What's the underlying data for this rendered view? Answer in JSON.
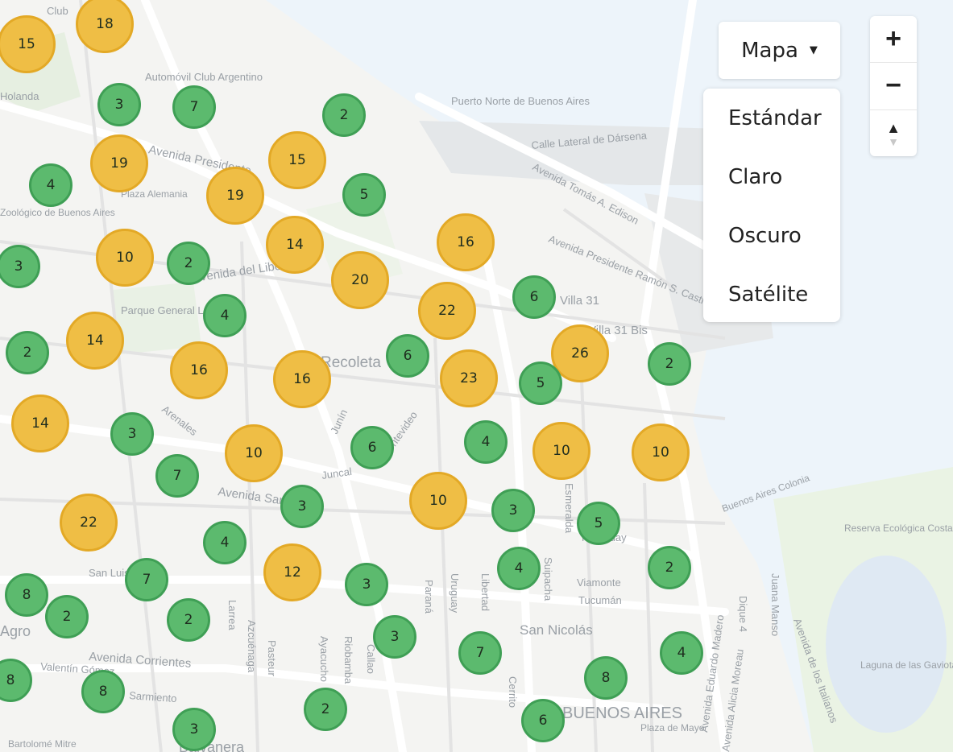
{
  "map": {
    "street_labels": [
      "Avenida Presidente",
      "Avenida del Libertador",
      "Avenida Santa Fe",
      "Avenida Corrientes",
      "Avenida Tomás A. Edison",
      "Avenida Presidente Ramón S. Castillo",
      "Calle Lateral de Dársena",
      "Avenida Eduardo Madero",
      "Avenida Alicia Moreau",
      "Juncal",
      "Arenales",
      "Junín",
      "Paraná",
      "Uruguay",
      "Libertad",
      "Cerrito",
      "Esmeralda",
      "Suipacha",
      "Viamonte",
      "Tucumán",
      "Sarmiento",
      "Pasteur",
      "Azcuénaga",
      "Ayacucho",
      "Riobamba",
      "Callao",
      "Larrea",
      "Juana Manso",
      "Dique 4",
      "Avenida de los Italianos",
      "Buenos Aires Colonia",
      "Paraguay",
      "Montevideo",
      "Bartolomé Mitre",
      "San Luis",
      "Valentín Gómez",
      "Plaza de Mayo"
    ],
    "place_labels": [
      "Club",
      "Automóvil Club Argentino",
      "Puerto Norte de Buenos Aires",
      "Recoleta",
      "San Nicolás",
      "BUENOS AIRES",
      "Reserva Ecológica Costanera Sur",
      "Laguna de las Gaviotas",
      "Villa 31",
      "Villa 31 Bis",
      "Parque General Las Heras",
      "Zoológico de Buenos Aires",
      "Balvanera",
      "Agro",
      "Plaza Alemania",
      "Holanda"
    ]
  },
  "clusters": [
    {
      "count": "15",
      "size": "large"
    },
    {
      "count": "18",
      "size": "large"
    },
    {
      "count": "3",
      "size": "small"
    },
    {
      "count": "7",
      "size": "small"
    },
    {
      "count": "2",
      "size": "small"
    },
    {
      "count": "19",
      "size": "large"
    },
    {
      "count": "15",
      "size": "large"
    },
    {
      "count": "4",
      "size": "small"
    },
    {
      "count": "19",
      "size": "large"
    },
    {
      "count": "5",
      "size": "small"
    },
    {
      "count": "10",
      "size": "large"
    },
    {
      "count": "2",
      "size": "small"
    },
    {
      "count": "14",
      "size": "large"
    },
    {
      "count": "16",
      "size": "large"
    },
    {
      "count": "3",
      "size": "small"
    },
    {
      "count": "20",
      "size": "large"
    },
    {
      "count": "22",
      "size": "large"
    },
    {
      "count": "6",
      "size": "small"
    },
    {
      "count": "4",
      "size": "small"
    },
    {
      "count": "14",
      "size": "large"
    },
    {
      "count": "2",
      "size": "small"
    },
    {
      "count": "16",
      "size": "large"
    },
    {
      "count": "16",
      "size": "large"
    },
    {
      "count": "6",
      "size": "small"
    },
    {
      "count": "23",
      "size": "large"
    },
    {
      "count": "26",
      "size": "large"
    },
    {
      "count": "5",
      "size": "small"
    },
    {
      "count": "2",
      "size": "small"
    },
    {
      "count": "14",
      "size": "large"
    },
    {
      "count": "3",
      "size": "small"
    },
    {
      "count": "10",
      "size": "large"
    },
    {
      "count": "6",
      "size": "small"
    },
    {
      "count": "4",
      "size": "small"
    },
    {
      "count": "10",
      "size": "large"
    },
    {
      "count": "10",
      "size": "large"
    },
    {
      "count": "7",
      "size": "small"
    },
    {
      "count": "3",
      "size": "small"
    },
    {
      "count": "10",
      "size": "large"
    },
    {
      "count": "3",
      "size": "small"
    },
    {
      "count": "5",
      "size": "small"
    },
    {
      "count": "22",
      "size": "large"
    },
    {
      "count": "4",
      "size": "small"
    },
    {
      "count": "12",
      "size": "large"
    },
    {
      "count": "3",
      "size": "small"
    },
    {
      "count": "4",
      "size": "small"
    },
    {
      "count": "2",
      "size": "small"
    },
    {
      "count": "7",
      "size": "small"
    },
    {
      "count": "8",
      "size": "small"
    },
    {
      "count": "2",
      "size": "small"
    },
    {
      "count": "2",
      "size": "small"
    },
    {
      "count": "3",
      "size": "small"
    },
    {
      "count": "7",
      "size": "small"
    },
    {
      "count": "4",
      "size": "small"
    },
    {
      "count": "8",
      "size": "small"
    },
    {
      "count": "8",
      "size": "small"
    },
    {
      "count": "8",
      "size": "small"
    },
    {
      "count": "2",
      "size": "small"
    },
    {
      "count": "6",
      "size": "small"
    },
    {
      "count": "3",
      "size": "small"
    }
  ],
  "controls": {
    "layer_button_label": "Mapa",
    "layer_options": [
      "Estándar",
      "Claro",
      "Oscuro",
      "Satélite"
    ],
    "zoom_in": "+",
    "zoom_out": "−",
    "compass_up": "▲",
    "compass_down": "▼"
  },
  "colors": {
    "small_cluster": "#5cba6e",
    "large_cluster": "#efbe45",
    "water": "#e8f1f8"
  }
}
